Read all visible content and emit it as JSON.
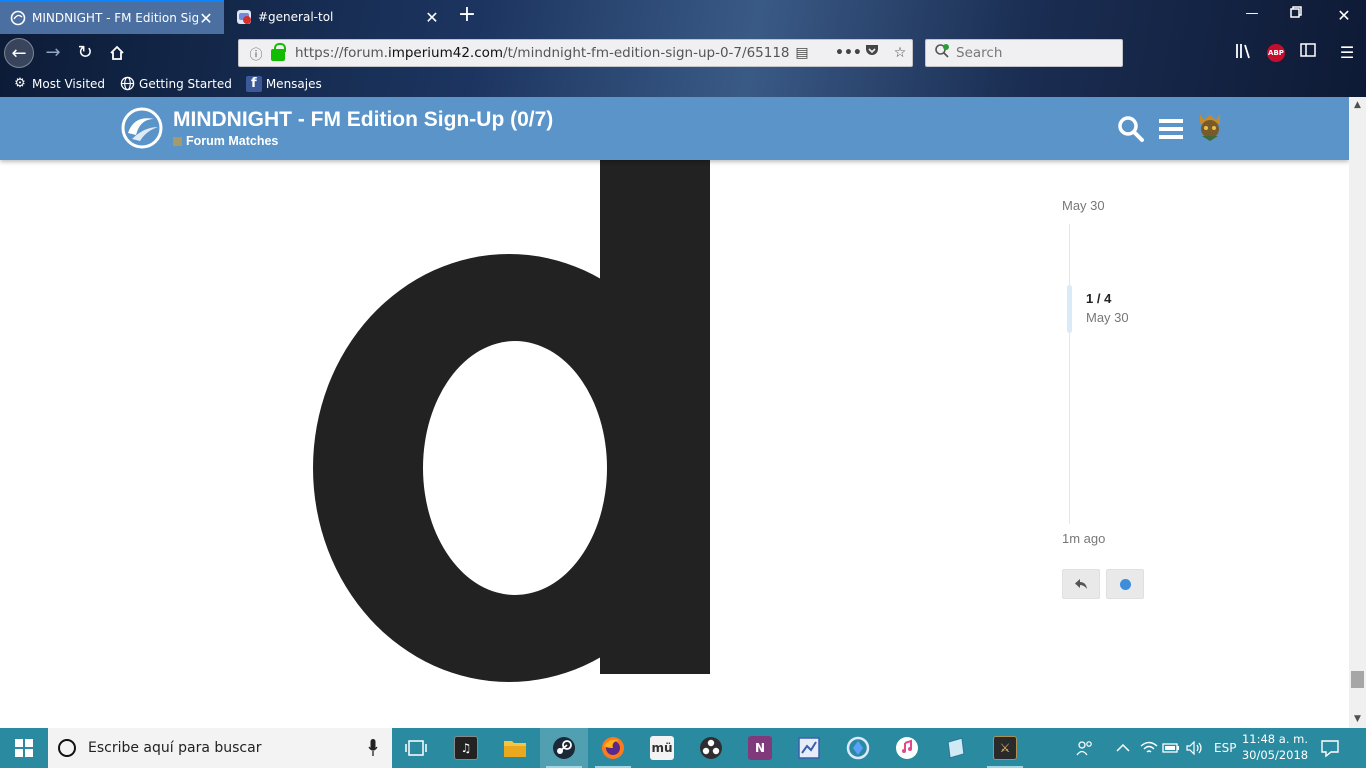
{
  "browser": {
    "tabs": [
      {
        "title": "MINDNIGHT - FM Edition Sign",
        "active": true
      },
      {
        "title": "#general-tol",
        "active": false
      }
    ],
    "url": {
      "prefix": "https://forum.",
      "domain": "imperium42.com",
      "path": "/t/mindnight-fm-edition-sign-up-0-7/65118"
    },
    "search_placeholder": "Search",
    "bookmarks": [
      "Most Visited",
      "Getting Started",
      "Mensajes"
    ],
    "abp_label": "ABP"
  },
  "forum": {
    "topic_title": "MINDNIGHT - FM Edition Sign-Up (0/7)",
    "category": "Forum Matches",
    "category_color": "#a49a6a",
    "header_color": "#5a94c8"
  },
  "timeline": {
    "start_date": "May 30",
    "position": "1 / 4",
    "position_date": "May 30",
    "end_label": "1m ago"
  },
  "taskbar": {
    "search_placeholder": "Escribe aquí para buscar",
    "language": "ESP",
    "time": "11:48 a. m.",
    "date": "30/05/2018"
  }
}
